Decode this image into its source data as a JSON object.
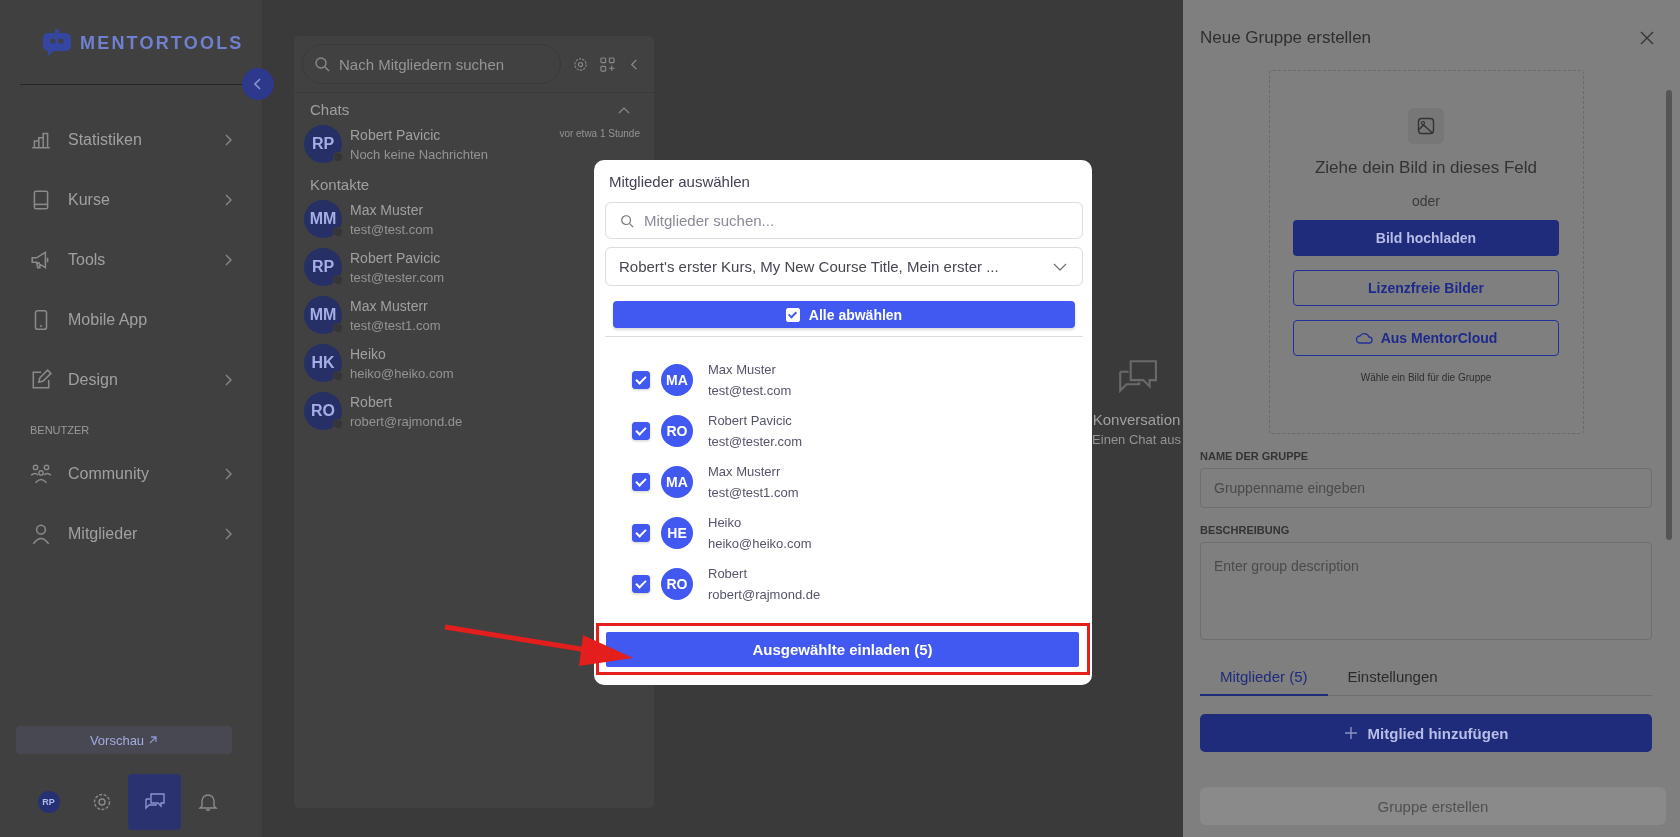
{
  "sidebar": {
    "logo": "MENTORTOOLS",
    "items": [
      {
        "kind": "chart",
        "label": "Statistiken",
        "has_submenu": true
      },
      {
        "kind": "book",
        "label": "Kurse",
        "has_submenu": true
      },
      {
        "kind": "megaphone",
        "label": "Tools",
        "has_submenu": true
      },
      {
        "kind": "phone",
        "label": "Mobile App",
        "has_submenu": false
      },
      {
        "kind": "pencil",
        "label": "Design",
        "has_submenu": true
      }
    ],
    "section": "BENUTZER",
    "section_items": [
      {
        "kind": "community",
        "label": "Community",
        "has_submenu": true
      },
      {
        "kind": "person",
        "label": "Mitglieder",
        "has_submenu": true
      }
    ],
    "preview": "Vorschau",
    "bottom_bar": [
      {
        "kind": "avatar",
        "initials": "RP",
        "selected": false
      },
      {
        "kind": "settings",
        "selected": false
      },
      {
        "kind": "chat",
        "selected": true
      },
      {
        "kind": "bell",
        "selected": false
      }
    ]
  },
  "chat_panel": {
    "search": {
      "placeholder": "Nach Mitgliedern suchen"
    },
    "chats_title": "Chats",
    "chats": [
      {
        "initials": "RP",
        "name": "Robert Pavicic",
        "preview": "Noch keine Nachrichten",
        "time": "vor etwa 1 Stunde"
      }
    ],
    "contacts_title": "Kontakte",
    "contacts": [
      {
        "initials": "MM",
        "name": "Max Muster",
        "email": "test@test.com"
      },
      {
        "initials": "RP",
        "name": "Robert Pavicic",
        "email": "test@tester.com"
      },
      {
        "initials": "MM",
        "name": "Max Musterr",
        "email": "test@test1.com"
      },
      {
        "initials": "HK",
        "name": "Heiko",
        "email": "heiko@heiko.com"
      },
      {
        "initials": "RO",
        "name": "Robert",
        "email": "robert@rajmond.de"
      }
    ]
  },
  "conversation": {
    "title": "Konversation",
    "subtitle": "Einen Chat aus"
  },
  "drawer": {
    "title": "Neue Gruppe erstellen",
    "dropzone": {
      "heading": "Ziehe dein Bild in dieses Feld",
      "or": "oder",
      "buttons": [
        {
          "kind": "primary",
          "label": "Bild hochladen"
        },
        {
          "kind": "outline",
          "label": "Lizenzfreie Bilder"
        },
        {
          "kind": "cloud",
          "label": "Aus MentorCloud"
        }
      ],
      "hint": "Wähle ein Bild für die Gruppe"
    },
    "name_field": {
      "label": "NAME DER GRUPPE",
      "placeholder": "Gruppenname eingeben"
    },
    "description_field": {
      "label": "BESCHREIBUNG",
      "placeholder": "Enter group description"
    },
    "tabs": [
      {
        "label": "Mitglieder (5)",
        "selected": true
      },
      {
        "label": "Einstellungen",
        "selected": false
      }
    ],
    "add_button": "Mitglied hinzufügen",
    "create_button": {
      "label": "Gruppe erstellen",
      "disabled": true
    }
  },
  "modal": {
    "title": "Mitglieder auswählen",
    "search": {
      "placeholder": "Mitglieder suchen..."
    },
    "course_select": "Robert's erster Kurs, My New Course Title, Mein erster ...",
    "select_all": {
      "label": "Alle abwählen",
      "checked": true
    },
    "members": [
      {
        "initials": "MA",
        "name": "Max Muster",
        "email": "test@test.com",
        "checked": true
      },
      {
        "initials": "RO",
        "name": "Robert Pavicic",
        "email": "test@tester.com",
        "checked": true
      },
      {
        "initials": "MA",
        "name": "Max Musterr",
        "email": "test@test1.com",
        "checked": true
      },
      {
        "initials": "HE",
        "name": "Heiko",
        "email": "heiko@heiko.com",
        "checked": true
      },
      {
        "initials": "RO",
        "name": "Robert",
        "email": "robert@rajmond.de",
        "checked": true
      }
    ],
    "invite_button": {
      "label": "Ausgewählte einladen (5)",
      "highlighted": true
    }
  }
}
